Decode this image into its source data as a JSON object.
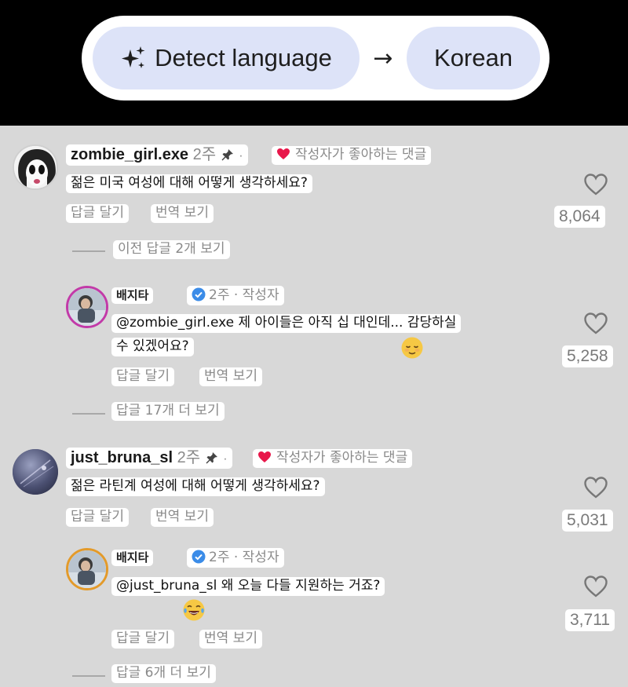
{
  "translate_bar": {
    "source_language": "Detect language",
    "arrow": "→",
    "target_language": "Korean"
  },
  "colors": {
    "pill": "#dde3f8",
    "feed_background": "#d8d8d8",
    "liked_heart": "#e8174a",
    "verified": "#3b8ce8"
  },
  "comments": [
    {
      "username": "zombie_girl.exe",
      "time": "2주",
      "liked_by_creator": "작성자가 좋아하는 댓글",
      "text": "젊은 미국 여성에 대해 어떻게 생각하세요?",
      "reply_label": "답글 달기",
      "translate_label": "번역 보기",
      "likes": "8,064",
      "thread_toggle": "이전 답글 2개 보기",
      "reply": {
        "username": "배지타",
        "meta": "2주 · 작성자",
        "text_line1": "@zombie_girl.exe 제 아이들은 아직 십 대인데... 감당하실",
        "text_line2": "수 있겠어요?",
        "emoji": "relieved-face",
        "reply_label": "답글 달기",
        "translate_label": "번역 보기",
        "likes": "5,258",
        "more_replies": "답글 17개 더 보기"
      }
    },
    {
      "username": "just_bruna_sl",
      "time": "2주",
      "liked_by_creator": "작성자가 좋아하는 댓글",
      "text": "젊은 라틴계 여성에 대해 어떻게 생각하세요?",
      "reply_label": "답글 달기",
      "translate_label": "번역 보기",
      "likes": "5,031",
      "reply": {
        "username": "배지타",
        "meta": "2주 · 작성자",
        "text_line1": "@just_bruna_sl 왜 오늘 다들 지원하는 거죠?",
        "emoji": "tears-of-joy",
        "reply_label": "답글 달기",
        "translate_label": "번역 보기",
        "likes": "3,711",
        "more_replies": "답글 6개 더 보기"
      }
    }
  ]
}
